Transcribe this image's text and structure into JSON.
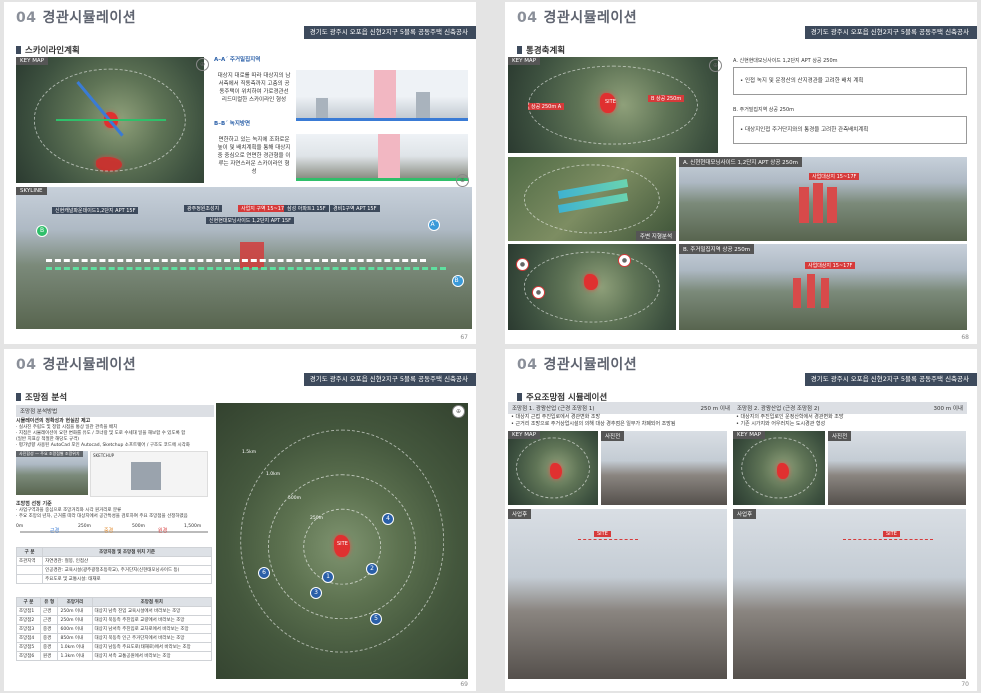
{
  "common": {
    "chapter_num": "04",
    "chapter_title": "경관시뮬레이션",
    "project_banner": "경기도 광주시 오포읍 신현2지구 5블록 공동주택 신축공사"
  },
  "page67": {
    "section": "스카이라인계획",
    "keymap_label": "KEY MAP",
    "section_aa": "A–A´ 주거밀집지역",
    "text_aa": "대상지 대로를 따라 대상지의 남서측에서 직동측까지 고층의 공동주택이 위치하여 가로경관선 리드미컬한 스카이라인 형성",
    "section_bb": "B–B´ 녹지방면",
    "text_bb": "면한하고 있는 녹지에 조화로운 높이 및 배치계획을 통해 대상지중 중심으로 연면한 경관형을 이루는 자연스러운 스카이라인 형성",
    "skyline_label": "SKYLINE",
    "tags": [
      "신현캐널파운데이드1,2단지 APT 15F",
      "광주정원조성지",
      "사업지 구역 15~17F",
      "신현현대모닝사이드 1,2단지 APT 15F",
      "삼성 아파트1 15F",
      "경비1구역 APT 15F"
    ],
    "markers": [
      "A",
      "A´",
      "B",
      "B´"
    ],
    "page_number": "67"
  },
  "page68": {
    "section": "통경축계획",
    "keymap_label": "KEY MAP",
    "map_tag_a": "상공 250m A",
    "map_tag_b": "B 상공 250m",
    "site_tag": "SITE",
    "note_a_title": "A. 신현현대모닝사이드 1,2단지 APT 상공 250m",
    "note_a_text": "• 인접 녹지 및 운정산의 산지경관을 고려한 배치 계획",
    "note_b_title": "B. 주거밀집지역 상공 250m",
    "note_b_text": "• 대상지인접 주거단지와의 통경을 고려한 관측배치계획",
    "view_a": "A. 신현현대모닝사이드 1,2단지 APT 상공 250m",
    "view_b": "B. 주거밀집지역 상공 250m",
    "view_a_tag": "사업대상지 15~17F",
    "view_b_tag": "사업대상지 15~17F",
    "analysis_label": "주변 지형분석",
    "page_number": "68"
  },
  "page69": {
    "section": "조망점 분석",
    "sub_method": "조망점 분석방법",
    "method_title": "시뮬레이션의 정확성과 현실감 제고",
    "method_lines": [
      "· 실사진 주립도 및 정합 시점을 통상 일관 관측을 배치",
      "· 지점은 시뮬레이션이 요한 변화를 유도 / 코너랑 및 도로 수세대 일을 해보함 수 있도록 함",
      "(일반 지표상 적절한 해당도 규격)",
      "· 평가방향 사용된 AutoCad 포인 Autocad, Sketchup 소프트웨어 / 구조도 코드에 시각화"
    ],
    "real_photo": "사진합성 — 주요 조망점별 조망위치",
    "sketchup": "SKETCHUP",
    "criteria_title": "조망점 선정 기준",
    "criteria_lines": [
      "· 사업구역과을 중심으로 조망거리와 시각 원거리로 분류",
      "· 주요 조망의 년차, 근거를 따라 대상지에서 공간특성을 검토하여 주요 조망점을 선정하였음"
    ],
    "distance_scale": [
      "0m",
      "근경",
      "250m",
      "중경",
      "500m",
      "원경",
      "1,500m"
    ],
    "table1_head": [
      "구 분",
      "조망지점 및 조망점 위치 기준"
    ],
    "table1_rows": [
      [
        "조관지역",
        "자연경관: 철봉, 인접산"
      ],
      [
        "",
        "인공경관: 교육시설(광주광정초등학교), 주거단지(신현태모닝사이드 등)"
      ],
      [
        "",
        "주요도로 및 교통시설: 태재로"
      ]
    ],
    "table2_head": [
      "구 분",
      "유 형",
      "조망거리",
      "조망점 위치"
    ],
    "table2_rows": [
      [
        "조망점1",
        "근경",
        "250m 이내",
        "대상지 남측 진입 교육시설에서 바라보는 조망"
      ],
      [
        "조망점2",
        "근경",
        "250m 이내",
        "대상지 북동측 주진입로 교량에서 바라보는 조망"
      ],
      [
        "조망점3",
        "중경",
        "600m 이내",
        "대상지 남서측 주진입로 교차로에서 바라보는 조망"
      ],
      [
        "조망점4",
        "중경",
        "850m 이내",
        "대상지 북동측 인근 주거단지에서 바라보는 조망"
      ],
      [
        "조망점5",
        "중경",
        "1.0km 이내",
        "대상지 남동측 주요도로(태재로)에서 바라보는 조망"
      ],
      [
        "조망점6",
        "원경",
        "1.3km 이내",
        "대상지 서측 교통공원에서 바라보는 조망"
      ]
    ],
    "map_distances": [
      "1.5km",
      "1.0km",
      "500m",
      "250m"
    ],
    "map_markers": [
      "1",
      "2",
      "3",
      "4",
      "5",
      "6"
    ],
    "site_tag": "SITE",
    "page_number": "69"
  },
  "page70": {
    "section": "주요조망점 시뮬레이션",
    "vp1_title": "조망점 1. 광왕산업 (근경 조망점 1)",
    "vp1_dist": "250 m 이내",
    "vp1_lines": [
      "• 대상지 근접 주진입로에서 경관변화 조망",
      "• 근거리 조망으로 주거상업시설의 의해 대상 경추점은 일부가 차폐되어 조망됨"
    ],
    "vp2_title": "조망점 2. 광왕산업 (근경 조망점 2)",
    "vp2_dist": "300 m 이내",
    "vp2_lines": [
      "• 대상지의 주진입로인 운정산학에서 경관변화 조망",
      "• 기존 시가지와 어우러지는 도시경관 형성"
    ],
    "keymap_label": "KEY MAP",
    "before_label": "사진전",
    "after_label": "사업후",
    "site_tag": "SITE",
    "page_number": "70"
  }
}
